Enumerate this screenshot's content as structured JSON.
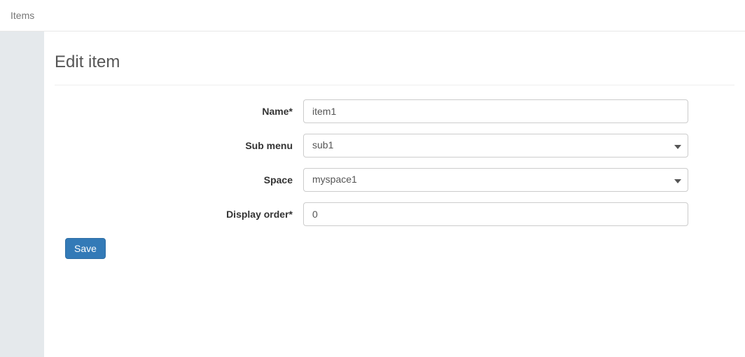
{
  "topbar": {
    "items_link": "Items"
  },
  "page": {
    "title": "Edit item"
  },
  "form": {
    "name": {
      "label": "Name*",
      "value": "item1"
    },
    "sub_menu": {
      "label": "Sub menu",
      "value": "sub1"
    },
    "space": {
      "label": "Space",
      "value": "myspace1"
    },
    "display_order": {
      "label": "Display order*",
      "value": "0"
    },
    "save_button": "Save"
  }
}
